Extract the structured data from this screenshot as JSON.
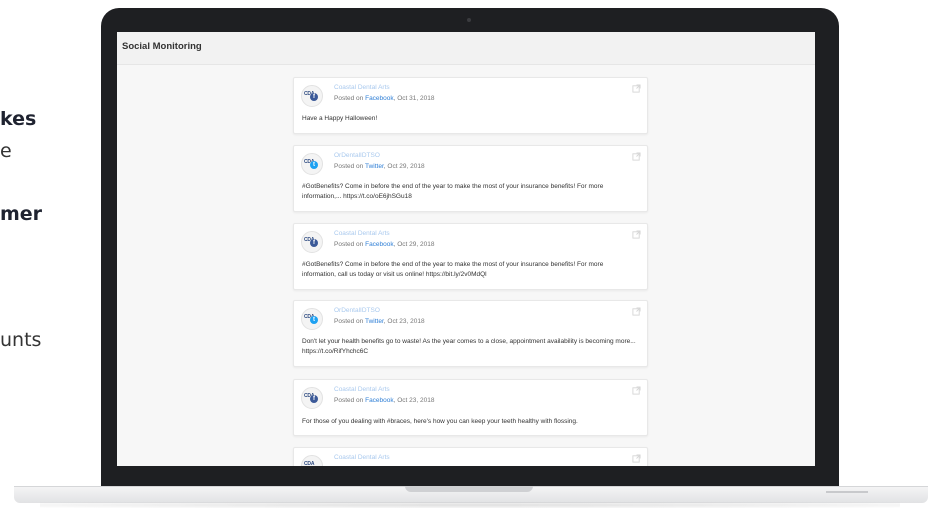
{
  "side_text": {
    "line1": "kes",
    "line2": "e",
    "line3": "mer",
    "line4": "unts"
  },
  "app": {
    "title": "Social Monitoring"
  },
  "posts": [
    {
      "account": "Coastal Dental Arts",
      "network": "Facebook",
      "prefix": "Posted on",
      "date": ", Oct 31, 2018",
      "message": "Have a Happy Halloween!"
    },
    {
      "account": "OrDentalIDTSO",
      "network": "Twitter",
      "prefix": "Posted on",
      "date": ", Oct 29, 2018",
      "message": "#GotBenefits? Come in before the end of the year to make the most of your insurance benefits! For more information,... https://t.co/oE6jhSGu18"
    },
    {
      "account": "Coastal Dental Arts",
      "network": "Facebook",
      "prefix": "Posted on",
      "date": ", Oct 29, 2018",
      "message": "#GotBenefits? Come in before the end of the year to make the most of your insurance benefits! For more information, call us today or visit us online! https://bit.ly/2v0MdQl"
    },
    {
      "account": "OrDentalIDTSO",
      "network": "Twitter",
      "prefix": "Posted on",
      "date": ", Oct 23, 2018",
      "message": "Don't let your health benefits go to waste! As the year comes to a close, appointment availability is becoming more... https://t.co/RifYhchc6C"
    },
    {
      "account": "Coastal Dental Arts",
      "network": "Facebook",
      "prefix": "Posted on",
      "date": ", Oct 23, 2018",
      "message": "For those of you dealing with #braces, here's how you can keep your teeth healthy with flossing."
    },
    {
      "account": "Coastal Dental Arts",
      "network": "",
      "prefix": "",
      "date": "",
      "message": ""
    }
  ],
  "avatar_text": "CDA",
  "colors": {
    "accent": "#2f7fd6",
    "facebook": "#3b5998",
    "twitter": "#1da1f2"
  },
  "icons": {
    "external": "external-link-icon"
  }
}
